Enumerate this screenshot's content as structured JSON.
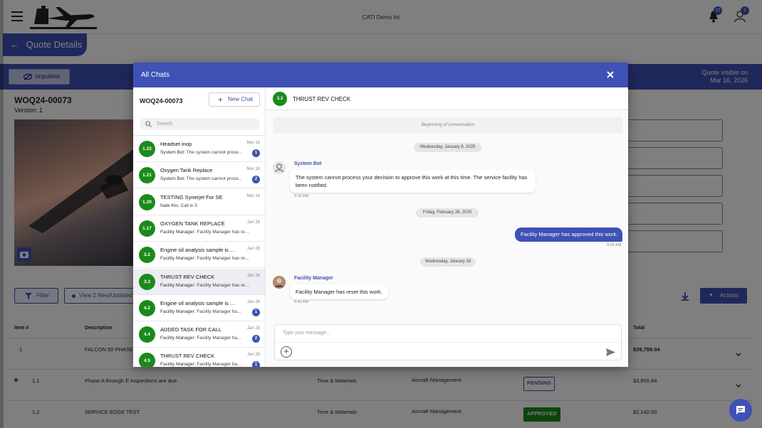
{
  "header": {
    "app_title": "CATI Demo Int",
    "notification_count": "10",
    "user_badge": "2"
  },
  "page": {
    "back_title": "Quote Details",
    "unpublish_label": "Unpublish",
    "quote_visible_line1": "Quote visible on",
    "quote_visible_line2": "Mar 16, 2026",
    "quote_number": "WOQ24-00073",
    "version": "Version: 1",
    "filter_label": "Filter",
    "view_new_label": "View 2 New/Updated",
    "actions_label": "Actions"
  },
  "table": {
    "headers": {
      "item": "Item #",
      "description": "Description",
      "total": "Total"
    },
    "rows": [
      {
        "item": "1",
        "description": "FALCON 50 PHASE",
        "total": "$39,799.04"
      },
      {
        "item": "1.1",
        "description": "Phase A through E inspections are due.",
        "billing": "Time & Materials",
        "category": "Aircraft Management",
        "status": "PENDING",
        "total": "$3,855.94"
      },
      {
        "item": "1.2",
        "description": "SERVICE EDGE TEST",
        "billing": "Time & Materials",
        "category": "Aircraft Management",
        "status": "APPROVED",
        "total": "$2,142.00"
      }
    ]
  },
  "colors": {
    "primary": "#3f51b5",
    "chat_avatar": "#1b8a1b",
    "approved": "#1b8a1b"
  },
  "modal": {
    "title": "All Chats",
    "quote_number": "WOQ24-00073",
    "new_chat_label": "New Chat",
    "search_placeholder": "Search",
    "chats": [
      {
        "code": "1.22",
        "title": "Headset inop",
        "date": "Mar 16",
        "sender": "System Bot:",
        "preview": "The system cannot proce...",
        "unread": "1"
      },
      {
        "code": "1.21",
        "title": "Oxygen Tank Replace",
        "date": "Mar 16",
        "sender": "System Bot:",
        "preview": "The system cannot proce...",
        "unread": "2"
      },
      {
        "code": "1.20",
        "title": "TESTING Synerjet For SE",
        "date": "Mar 16",
        "sender": "Nate Klo:",
        "preview": "Call in 5",
        "unread": ""
      },
      {
        "code": "1.17",
        "title": "OXYGEN TANK REPLACE",
        "date": "Jan 28",
        "sender": "Facility Manager:",
        "preview": "Facility Manager has res...",
        "unread": ""
      },
      {
        "code": "3.2",
        "title": "Engine oil analysis sample is due.",
        "date": "Jan 28",
        "sender": "Facility Manager:",
        "preview": "Facility Manager has res...",
        "unread": ""
      },
      {
        "code": "3.3",
        "title": "THRUST REV CHECK",
        "date": "Jan 28",
        "sender": "Facility Manager:",
        "preview": "Facility Manager has res...",
        "unread": ""
      },
      {
        "code": "4.2",
        "title": "Engine oil analysis sample is due.",
        "date": "Jan 28",
        "sender": "Facility Manager:",
        "preview": "Facility Manager ha...",
        "unread": "1"
      },
      {
        "code": "4.4",
        "title": "ADDED TASK FOR CALL",
        "date": "Jan 28",
        "sender": "Facility Manager:",
        "preview": "Facility Manager ha...",
        "unread": "2"
      },
      {
        "code": "4.5",
        "title": "THRUST REV CHECK",
        "date": "Jan 28",
        "sender": "Facility Manager:",
        "preview": "Facility Manager ha...",
        "unread": "1"
      }
    ],
    "conversation": {
      "code": "3.3",
      "title": "THRUST REV CHECK",
      "beginning": "Beginning of conversation",
      "date1": "Wednesday, January 8, 2025",
      "msg1_sender": "System Bot",
      "msg1_text": "The system cannot process your decision to approve this work at this time. The service facility has been notified.",
      "msg1_time": "9:25 AM",
      "date2": "Friday, February 28, 2025",
      "msg2_text": "Facility Manager has approved this work.",
      "msg2_time": "9:55 AM",
      "date3": "Wednesday, January 28",
      "msg3_sender": "Facility Manager",
      "msg3_text": "Facility Manager has reset this work.",
      "msg3_time": "8:49 AM",
      "compose_placeholder": "Type your message..."
    }
  }
}
